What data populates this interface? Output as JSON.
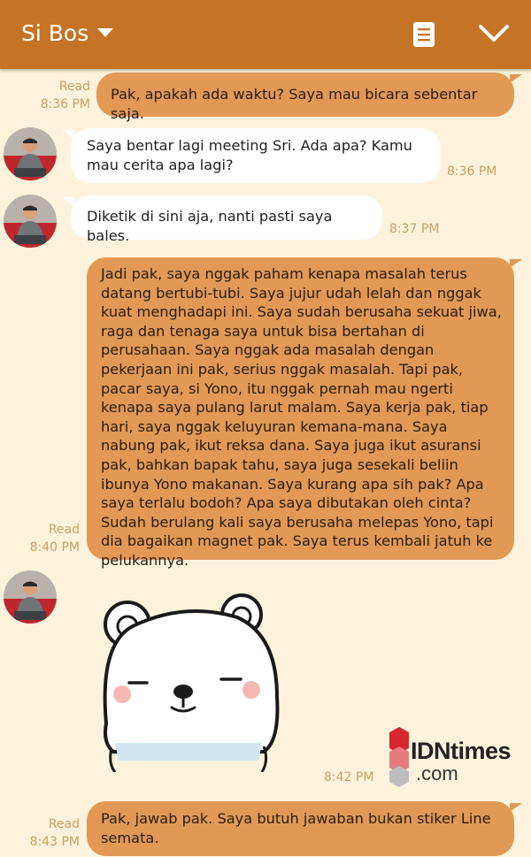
{
  "header": {
    "contact_name": "Si Bos",
    "dropdown_icon": "caret-down-icon",
    "note_icon": "note-icon",
    "collapse_icon": "chevron-down-icon"
  },
  "messages": [
    {
      "id": "m1",
      "direction": "out",
      "text": "Pak, apakah ada waktu? Saya mau bicara sebentar saja.",
      "read": "Read",
      "time": "8:36 PM"
    },
    {
      "id": "m2",
      "direction": "in",
      "text": "Saya bentar lagi meeting Sri. Ada apa? Kamu mau cerita apa lagi?",
      "time": "8:36 PM"
    },
    {
      "id": "m3",
      "direction": "in",
      "text": "Diketik di sini aja, nanti pasti saya bales.",
      "time": "8:37 PM"
    },
    {
      "id": "m4",
      "direction": "out",
      "text": "Jadi pak, saya nggak paham kenapa masalah terus datang bertubi-tubi. Saya jujur udah lelah dan nggak kuat menghadapi ini. Saya sudah berusaha sekuat jiwa, raga dan tenaga saya untuk bisa bertahan di perusahaan. Saya nggak ada masalah dengan pekerjaan ini pak, serius nggak masalah. Tapi pak, pacar saya, si Yono, itu nggak pernah mau ngerti kenapa saya pulang larut malam. Saya kerja pak, tiap hari, saya nggak keluyuran kemana-mana. Saya nabung pak, ikut reksa dana. Saya juga ikut asuransi pak, bahkan bapak tahu, saya juga sesekali beliin ibunya Yono makanan. Saya kurang apa sih pak? Apa saya terlalu bodoh? Apa saya dibutakan oleh cinta? Sudah berulang kali saya berusaha melepas Yono, tapi dia bagaikan magnet pak. Saya terus kembali jatuh ke pelukannya.",
      "read": "Read",
      "time": "8:40 PM"
    },
    {
      "id": "m5",
      "direction": "in",
      "type": "sticker",
      "sticker": "white-bear-sticker",
      "time": "8:42 PM"
    },
    {
      "id": "m6",
      "direction": "out",
      "text": "Pak, jawab pak. Saya butuh jawaban bukan stiker Line semata.",
      "read": "Read",
      "time": "8:43 PM"
    }
  ],
  "watermark": {
    "brand": "IDNtimes",
    "suffix": ".com"
  },
  "colors": {
    "header_bg": "#c57325",
    "chat_bg": "#fdf3dc",
    "outgoing_bubble": "#e19955",
    "incoming_bubble": "#ffffff",
    "timestamp": "#c9a062",
    "logo_red": "#d7262e"
  }
}
